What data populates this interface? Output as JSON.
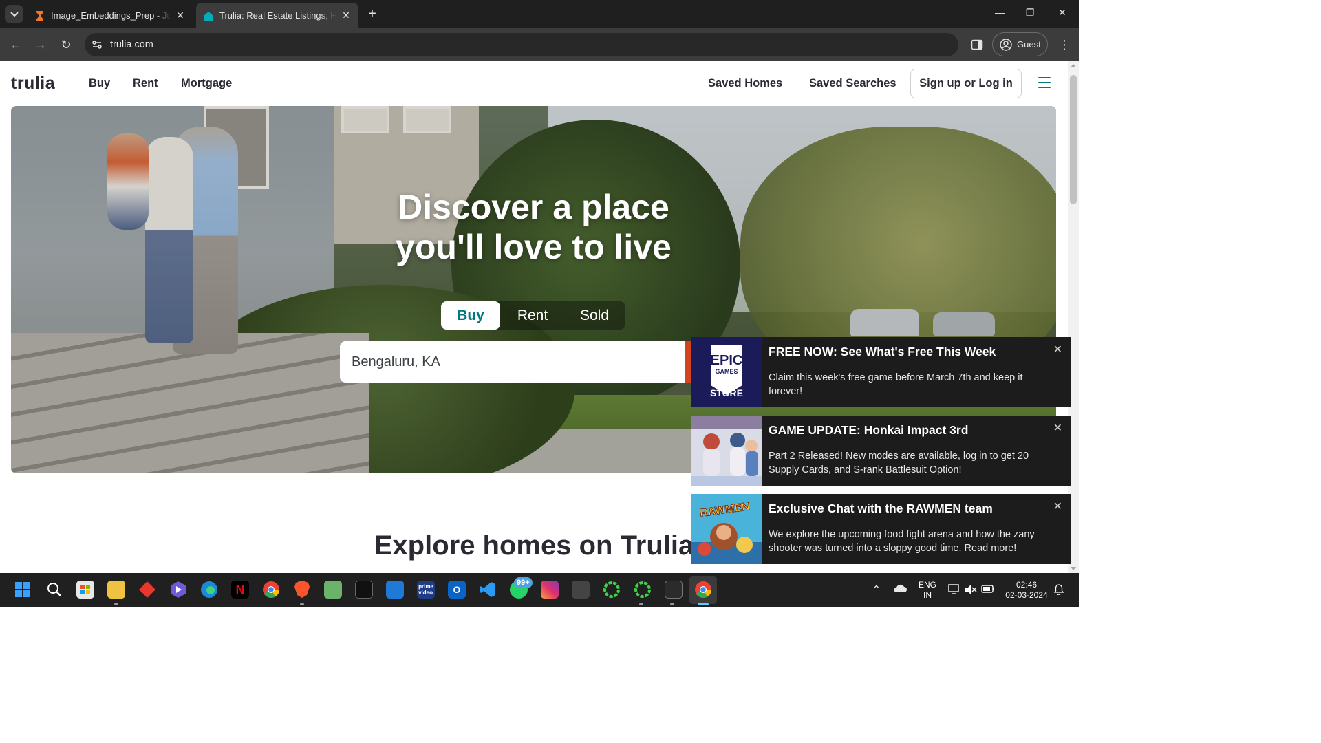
{
  "browser": {
    "tabs": [
      {
        "title": "Image_Embeddings_Prep - Jupyter",
        "favicon": "hourglass-icon",
        "active": false
      },
      {
        "title": "Trulia: Real Estate Listings, Homes",
        "favicon": "trulia-house-icon",
        "active": true
      }
    ],
    "url": "trulia.com",
    "profile_label": "Guest"
  },
  "site": {
    "logo": "trulia",
    "nav_left": [
      "Buy",
      "Rent",
      "Mortgage"
    ],
    "nav_right": [
      "Saved Homes",
      "Saved Searches"
    ],
    "signin_label": "Sign up or Log in",
    "accent": "#007882"
  },
  "hero": {
    "title_line1": "Discover a place",
    "title_line2": "you'll love to live",
    "tabs": [
      "Buy",
      "Rent",
      "Sold"
    ],
    "active_tab": "Buy",
    "search_value": "Bengaluru, KA"
  },
  "section": {
    "explore_title": "Explore homes on Trulia"
  },
  "notifications": [
    {
      "title": "FREE NOW: See What's Free This Week",
      "message": "Claim this week's free game before March 7th and keep it forever!",
      "thumb_text": {
        "line1": "EPIC",
        "line2": "GAMES",
        "line3": "STORE"
      }
    },
    {
      "title": "GAME UPDATE: Honkai Impact 3rd",
      "message": "Part 2 Released! New modes are available, log in to get 20 Supply Cards, and S-rank Battlesuit Option!"
    },
    {
      "title": "Exclusive Chat with the RAWMEN team",
      "message": "We explore the upcoming food fight arena and how the zany shooter was turned into a sloppy good time. Read more!",
      "thumb_text": "RAWMEN"
    }
  ],
  "taskbar": {
    "whatsapp_badge": "99+",
    "lang_line1": "ENG",
    "lang_line2": "IN",
    "time": "02:46",
    "date": "02-03-2024"
  }
}
